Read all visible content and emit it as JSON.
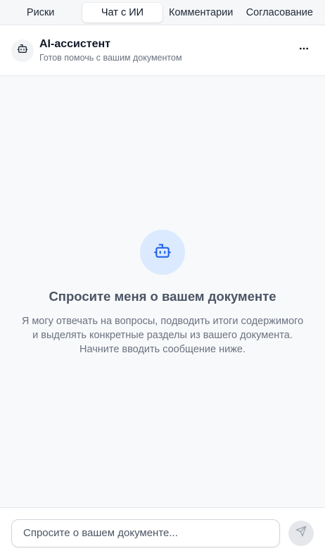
{
  "tabs": [
    {
      "label": "Риски",
      "active": false
    },
    {
      "label": "Чат с ИИ",
      "active": true
    },
    {
      "label": "Комментарии",
      "active": false
    },
    {
      "label": "Согласование",
      "active": false
    }
  ],
  "header": {
    "title": "AI-ассистент",
    "subtitle": "Готов помочь с вашим документом",
    "avatar_icon": "robot-icon",
    "menu_icon": "more-horizontal-icon"
  },
  "empty_state": {
    "icon": "robot-icon",
    "title": "Спросите меня о вашем документе",
    "description": "Я могу отвечать на вопросы, подводить итоги содержимого и выделять конкретные разделы из вашего документа. Начните вводить сообщение ниже."
  },
  "composer": {
    "placeholder": "Спросите о вашем документе...",
    "send_icon": "send-icon"
  },
  "colors": {
    "accent": "#2563eb",
    "accent_bg": "#dbeafe"
  }
}
